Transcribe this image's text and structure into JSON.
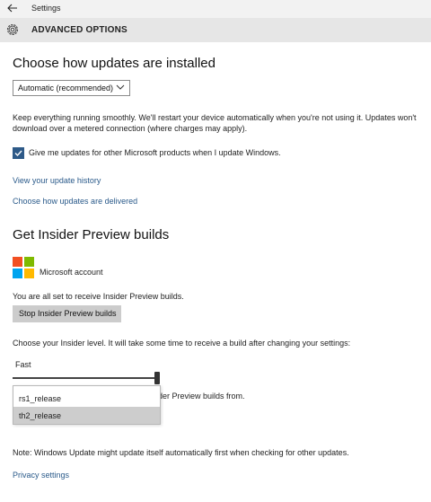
{
  "titlebar": {
    "app_title": "Settings",
    "back_icon": "back-arrow-icon"
  },
  "header": {
    "title": "ADVANCED OPTIONS",
    "icon": "gear-icon"
  },
  "updates": {
    "heading": "Choose how updates are installed",
    "dropdown_value": "Automatic (recommended)",
    "description_line1": "Keep everything running smoothly. We'll restart your device automatically when you're not using it. Updates won't",
    "description_line2": "download over a metered connection (where charges may apply).",
    "checkbox_checked": true,
    "checkbox_label": "Give me updates for other Microsoft products when I update Windows.",
    "link_history": "View your update history",
    "link_delivery": "Choose how updates are delivered"
  },
  "insider": {
    "heading": "Get Insider Preview builds",
    "account_label": "Microsoft account",
    "status_text": "You are all set to receive Insider Preview builds.",
    "stop_button": "Stop Insider Preview builds",
    "level_text": "Choose your Insider level. It will take some time to receive a build after changing your settings:",
    "level_value": "Fast",
    "slider_value_percent": 100,
    "branch_options": [
      "rs1_release",
      "th2_release"
    ],
    "branch_selected": "th2_release",
    "obscured_text": "der Preview builds from."
  },
  "footer": {
    "note": "Note: Windows Update might update itself automatically first when checking for other updates.",
    "privacy_link": "Privacy settings"
  },
  "colors": {
    "ms_red": "#f25022",
    "ms_green": "#7fba00",
    "ms_blue": "#00a4ef",
    "ms_yellow": "#ffb900",
    "link": "#2a5a8a",
    "checkbox": "#2e5a88"
  }
}
